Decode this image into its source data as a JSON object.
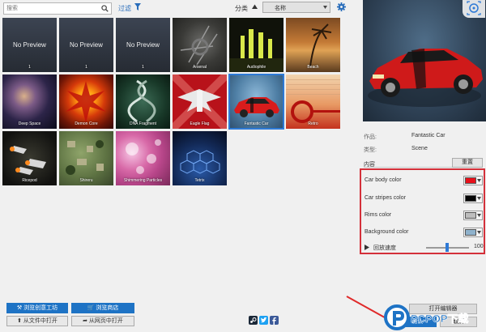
{
  "toolbar": {
    "search_placeholder": "搜索",
    "filter_label": "过滤",
    "sort_label": "分类",
    "sort_value": "名称"
  },
  "tiles": [
    {
      "name": "",
      "sub": "1",
      "no_preview": true,
      "np_text": "No Preview"
    },
    {
      "name": "",
      "sub": "1",
      "no_preview": true,
      "np_text": "No Preview"
    },
    {
      "name": "",
      "sub": "1",
      "no_preview": true,
      "np_text": "No Preview"
    },
    {
      "name": "Arsenal"
    },
    {
      "name": "Audiophile"
    },
    {
      "name": "Beach"
    },
    {
      "name": "Deep Space"
    },
    {
      "name": "Demon Core"
    },
    {
      "name": "DNA Fragment"
    },
    {
      "name": "Eagle Flag"
    },
    {
      "name": "Fantastic Car",
      "selected": true
    },
    {
      "name": "Retro"
    },
    {
      "name": "Ricepod"
    },
    {
      "name": "Shireru"
    },
    {
      "name": "Shimmering Particles"
    },
    {
      "name": "Tetrix"
    }
  ],
  "details": {
    "author_label": "作品:",
    "author_value": "Fantastic Car",
    "type_label": "类型:",
    "type_value": "Scene",
    "content_label": "内容",
    "reset_label": "重置"
  },
  "properties": [
    {
      "label": "Car body color",
      "color": "#e8101a"
    },
    {
      "label": "Car stripes color",
      "color": "#050505"
    },
    {
      "label": "Rims color",
      "color": "#bdbdbd"
    },
    {
      "label": "Background color",
      "color": "#8fb2cc"
    }
  ],
  "speed": {
    "label": "回放速度",
    "value": "100",
    "fraction": 0.45
  },
  "bottom": {
    "browse_workshop": "浏览创意工坊",
    "browse_store": "浏览商店",
    "open_file": "从文件中打开",
    "open_web": "从网页中打开",
    "open_editor": "打开编辑器",
    "ok": "确认",
    "cancel": "取消"
  },
  "colors": {
    "accent": "#1e73c5",
    "highlight": "#d4303a"
  },
  "watermark": {
    "text": "PCPOP下载"
  }
}
